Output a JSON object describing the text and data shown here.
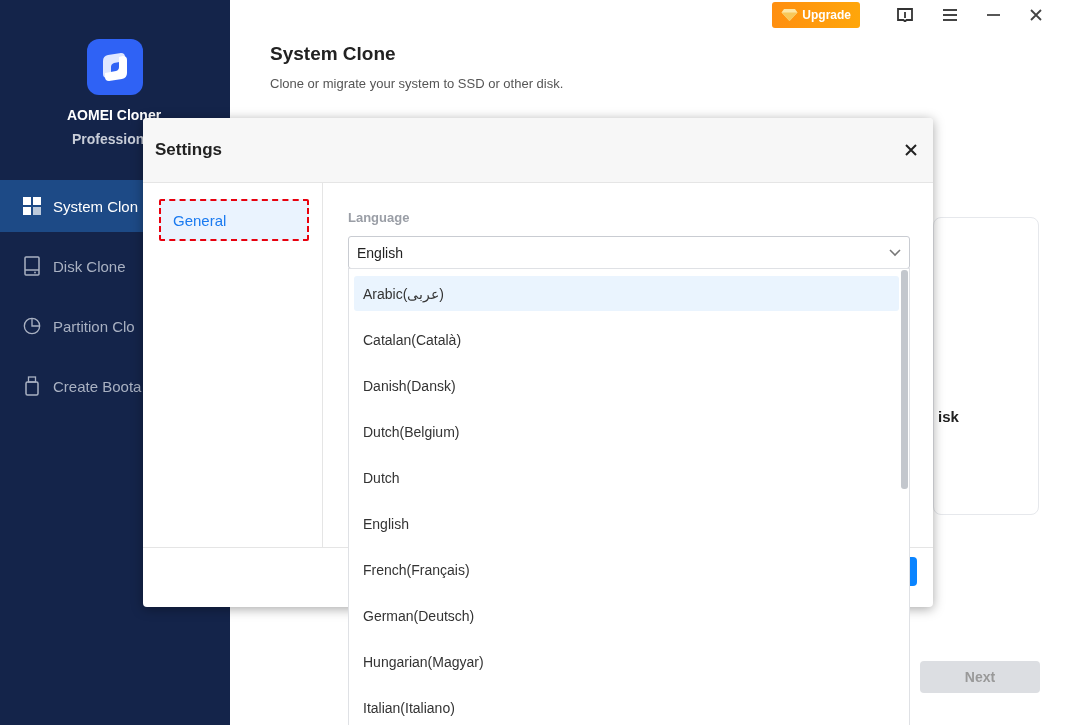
{
  "app": {
    "name": "AOMEI Cloner",
    "edition": "Profession"
  },
  "sidebar": {
    "items": [
      {
        "label": "System Clon",
        "kind": "system",
        "selected": true
      },
      {
        "label": "Disk Clone",
        "kind": "disk",
        "selected": false
      },
      {
        "label": "Partition Clo",
        "kind": "partition",
        "selected": false
      },
      {
        "label": "Create Boota",
        "kind": "bootable",
        "selected": false
      }
    ]
  },
  "title_bar": {
    "upgrade": "Upgrade"
  },
  "page": {
    "title": "System Clone",
    "subtitle": "Clone or migrate your system to SSD or other disk.",
    "card_text": "isk",
    "next": {
      "label": "Next",
      "disabled": true
    }
  },
  "dialog": {
    "title": "Settings",
    "nav": [
      {
        "label": "General",
        "selected": true
      }
    ],
    "language": {
      "label": "Language",
      "value": "English",
      "options": [
        {
          "label": "Arabic(عربى)",
          "highlighted": true
        },
        {
          "label": "Catalan(Català)",
          "highlighted": false
        },
        {
          "label": "Danish(Dansk)",
          "highlighted": false
        },
        {
          "label": "Dutch(Belgium)",
          "highlighted": false
        },
        {
          "label": "Dutch",
          "highlighted": false
        },
        {
          "label": "English",
          "highlighted": false
        },
        {
          "label": "French(Français)",
          "highlighted": false
        },
        {
          "label": "German(Deutsch)",
          "highlighted": false
        },
        {
          "label": "Hungarian(Magyar)",
          "highlighted": false
        },
        {
          "label": "Italian(Italiano)",
          "highlighted": false
        }
      ]
    }
  }
}
